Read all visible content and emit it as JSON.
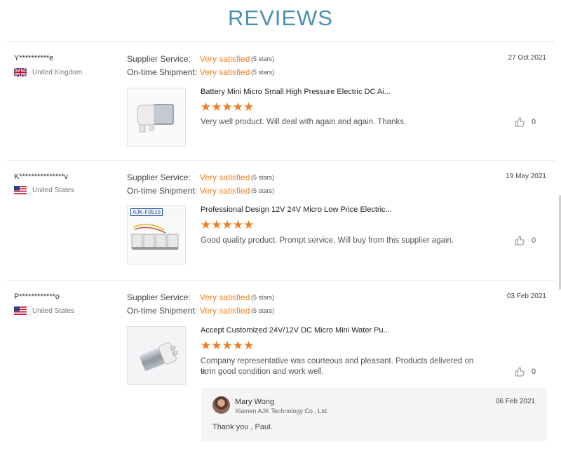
{
  "header": {
    "title": "REVIEWS"
  },
  "labels": {
    "supplier": "Supplier Service:",
    "shipment": "On-time Shipment:"
  },
  "reviews": [
    {
      "user": "Y**********e",
      "country": "United Kingdom",
      "date": "27 Oct 2021",
      "supplier_rating": "Very satisfied",
      "supplier_stars": "(5 stars)",
      "shipment_rating": "Very satisfied",
      "shipment_stars": "(5 stars)",
      "product": "Battery Mini Micro Small High Pressure Electric DC Ai...",
      "stars": "★★★★★",
      "comment": "Very well product. Will deal with again and again. Thanks.",
      "likes": "0"
    },
    {
      "user": "K***************v",
      "country": "United States",
      "date": "19 May 2021",
      "supplier_rating": "Very satisfied",
      "supplier_stars": "(5 stars)",
      "shipment_rating": "Very satisfied",
      "shipment_stars": "(5 stars)",
      "product": "Professional Design 12V 24V Micro Low Price Electric...",
      "product_image_text": "AJK-F0515",
      "stars": "★★★★★",
      "comment": "Good quality product. Prompt service. Will buy from this supplier again.",
      "likes": "0"
    },
    {
      "user": "P************o",
      "country": "United States",
      "date": "03 Feb 2021",
      "supplier_rating": "Very satisfied",
      "supplier_stars": "(5 stars)",
      "shipment_rating": "Very satisfied",
      "shipment_stars": "(5 stars)",
      "product": "Accept Customized 24V/12V DC Micro Mini Water Pu...",
      "stars": "★★★★★",
      "comment_line1": "Company representative was courteous and pleasant.  Products delivered on tim",
      "comment_line2": "e, in good condition and work well.",
      "likes": "0",
      "reply": {
        "name": "Mary Wong",
        "company": "Xiamen AJK Technology Co., Ltd.",
        "date": "06 Feb 2021",
        "text": "Thank you , Paul."
      }
    }
  ]
}
